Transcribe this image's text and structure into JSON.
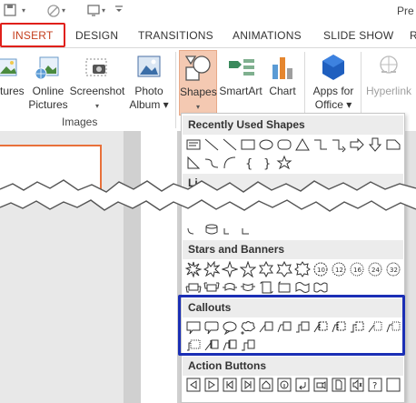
{
  "title_bar": {
    "app_title": "Pre"
  },
  "tabs": [
    {
      "label": "INSERT"
    },
    {
      "label": "DESIGN"
    },
    {
      "label": "TRANSITIONS"
    },
    {
      "label": "ANIMATIONS"
    },
    {
      "label": "SLIDE SHOW"
    },
    {
      "label": "R"
    }
  ],
  "ribbon": {
    "pictures": {
      "label": "ctures"
    },
    "online_pictures": {
      "line1": "Online",
      "line2": "Pictures"
    },
    "screenshot": {
      "line1": "Screenshot",
      "caret": "▾"
    },
    "photo_album": {
      "line1": "Photo",
      "line2": "Album ▾"
    },
    "images_group": "Images",
    "shapes": {
      "line1": "Shapes",
      "caret": "▾"
    },
    "smartart": {
      "line1": "SmartArt"
    },
    "chart": {
      "line1": "Chart"
    },
    "apps_for_office": {
      "line1": "Apps for",
      "line2": "Office ▾"
    },
    "hyperlink": {
      "line1": "Hyperlink"
    }
  },
  "gallery": {
    "recently_used": "Recently Used Shapes",
    "lines_partial": "Li",
    "stars_banners": "Stars and Banners",
    "callouts": "Callouts",
    "action_buttons": "Action Buttons"
  },
  "colors": {
    "accent": "#c43e1c",
    "highlight_red": "#e0201a",
    "highlight_blue": "#1b2fb5",
    "shapes_selected": "#f4c9b2",
    "section_header": "#ececec"
  }
}
